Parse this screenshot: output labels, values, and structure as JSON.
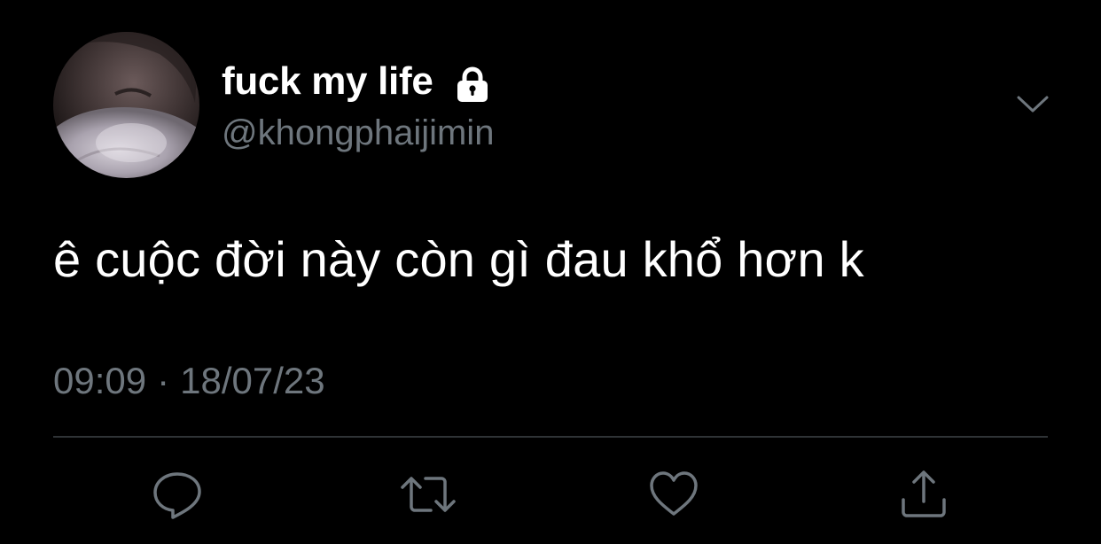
{
  "tweet": {
    "display_name": "fuck my life",
    "handle": "@khongphaijimin",
    "text": "ê cuộc đời này còn gì đau khổ hơn k",
    "time": "09:09",
    "separator": "·",
    "date": "18/07/23",
    "protected": true
  },
  "icons": {
    "lock": "lock-icon",
    "menu": "chevron-down-icon",
    "reply": "reply-icon",
    "retweet": "retweet-icon",
    "like": "heart-icon",
    "share": "share-icon"
  },
  "colors": {
    "background": "#000000",
    "text": "#ffffff",
    "secondary": "#6e767d",
    "divider": "#2f3336"
  }
}
